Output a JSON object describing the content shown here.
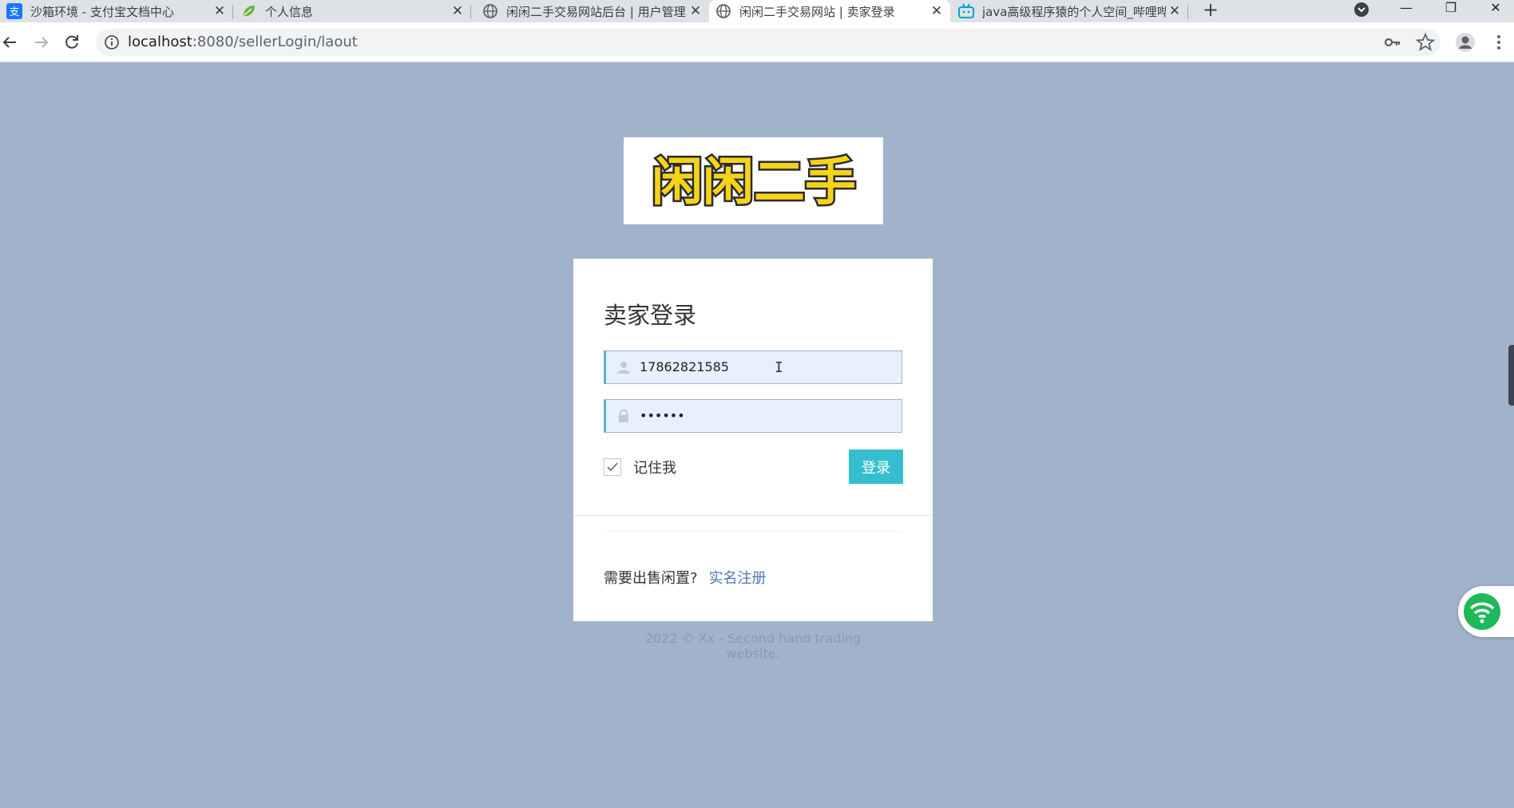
{
  "browser": {
    "tabs": [
      {
        "title": "沙箱环境 - 支付宝文档中心",
        "icon": "alipay-icon",
        "active": false
      },
      {
        "title": "个人信息",
        "icon": "leaf-icon",
        "active": false
      },
      {
        "title": "闲闲二手交易网站后台 | 用户管理",
        "icon": "globe-icon",
        "active": false
      },
      {
        "title": "闲闲二手交易网站 | 卖家登录",
        "icon": "globe-icon",
        "active": true
      },
      {
        "title": "java高级程序猿的个人空间_哔哩哔哩",
        "icon": "bilibili-icon",
        "active": false
      }
    ],
    "url_host": "localhost",
    "url_path": ":8080/sellerLogin/laout"
  },
  "page": {
    "logo_text": "闲闲二手",
    "form": {
      "title": "卖家登录",
      "username_value": "17862821585",
      "password_value": "••••••",
      "remember_label": "记住我",
      "remember_checked": true,
      "login_label": "登录",
      "register_prompt": "需要出售闲置?",
      "register_link": "实名注册"
    },
    "footer": "2022 © Xx - Second hand trading website."
  },
  "colors": {
    "page_bg": "#a1b3cb",
    "accent": "#35bdd0",
    "link": "#4a7ab5"
  }
}
